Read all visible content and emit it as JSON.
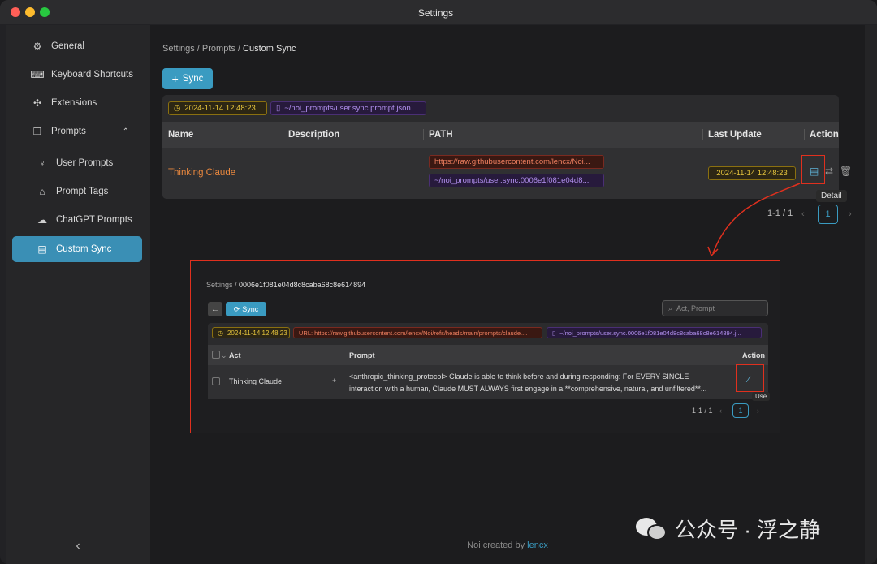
{
  "window": {
    "title": "Settings"
  },
  "sidebar": {
    "items": [
      {
        "label": "General",
        "icon": "gear-icon"
      },
      {
        "label": "Keyboard Shortcuts",
        "icon": "keyboard-icon"
      },
      {
        "label": "Extensions",
        "icon": "puzzle-icon"
      },
      {
        "label": "Prompts",
        "icon": "prompt-icon",
        "expanded": true
      },
      {
        "label": "User Prompts",
        "icon": "bulb-icon"
      },
      {
        "label": "Prompt Tags",
        "icon": "tag-icon"
      },
      {
        "label": "ChatGPT Prompts",
        "icon": "cloud-icon"
      },
      {
        "label": "Custom Sync",
        "icon": "document-icon",
        "active": true
      }
    ],
    "collapse_glyph": "‹"
  },
  "main": {
    "breadcrumb": {
      "parent": "Settings / Prompts / ",
      "current": "Custom Sync"
    },
    "sync_button": "Sync",
    "info": {
      "time": "2024-11-14 12:48:23",
      "path": "~/noi_prompts/user.sync.prompt.json"
    },
    "table": {
      "headers": {
        "name": "Name",
        "description": "Description",
        "path": "PATH",
        "last_update": "Last Update",
        "action": "Action"
      },
      "rows": [
        {
          "name": "Thinking Claude",
          "description": "",
          "url": "https://raw.githubusercontent.com/lencx/Noi...",
          "local_path": "~/noi_prompts/user.sync.0006e1f081e04d8...",
          "last_update": "2024-11-14 12:48:23"
        }
      ]
    },
    "tooltip": "Detail",
    "pagination": {
      "range": "1-1 / 1",
      "page": "1"
    }
  },
  "inset": {
    "breadcrumb": {
      "parent": "Settings / ",
      "current": "0006e1f081e04d8c8caba68c8e614894"
    },
    "sync_button": "Sync",
    "search_placeholder": "Act, Prompt",
    "info": {
      "time": "2024-11-14 12:48:23",
      "url": "URL: https://raw.githubusercontent.com/lencx/Noi/refs/heads/main/prompts/claude....",
      "path": "~/noi_prompts/user.sync.0006e1f081e04d8c8caba68c8e614894.j..."
    },
    "table": {
      "headers": {
        "act": "Act",
        "prompt": "Prompt",
        "action": "Action"
      },
      "rows": [
        {
          "act": "Thinking Claude",
          "prompt_line1": "<anthropic_thinking_protocol> Claude is able to think before and during responding: For EVERY SINGLE",
          "prompt_line2": "interaction with a human, Claude MUST ALWAYS first engage in a **comprehensive, natural, and unfiltered**..."
        }
      ]
    },
    "tooltip": "Use",
    "pagination": {
      "range": "1-1 / 1",
      "page": "1"
    }
  },
  "footer": {
    "prefix": "Noi created by ",
    "link": "lencx"
  },
  "watermark": "公众号 · 浮之静",
  "colors": {
    "accent": "#3a9bc1",
    "highlight": "#e0301e",
    "name_text": "#e8873e"
  }
}
